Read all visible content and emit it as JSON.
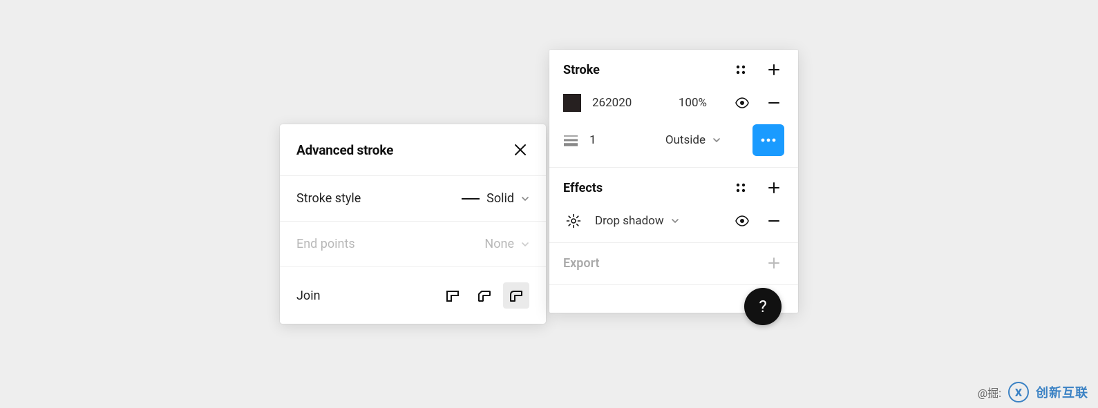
{
  "popover": {
    "title": "Advanced stroke",
    "stroke_style_label": "Stroke style",
    "stroke_style_value": "Solid",
    "end_points_label": "End points",
    "end_points_value": "None",
    "join_label": "Join"
  },
  "panel": {
    "stroke": {
      "title": "Stroke",
      "hex": "262020",
      "opacity": "100%",
      "width": "1",
      "position": "Outside"
    },
    "effects": {
      "title": "Effects",
      "item": "Drop shadow"
    },
    "export": {
      "title": "Export"
    }
  },
  "help": "?",
  "watermark": {
    "attrib": "@掘:",
    "brand": "创新互联"
  }
}
